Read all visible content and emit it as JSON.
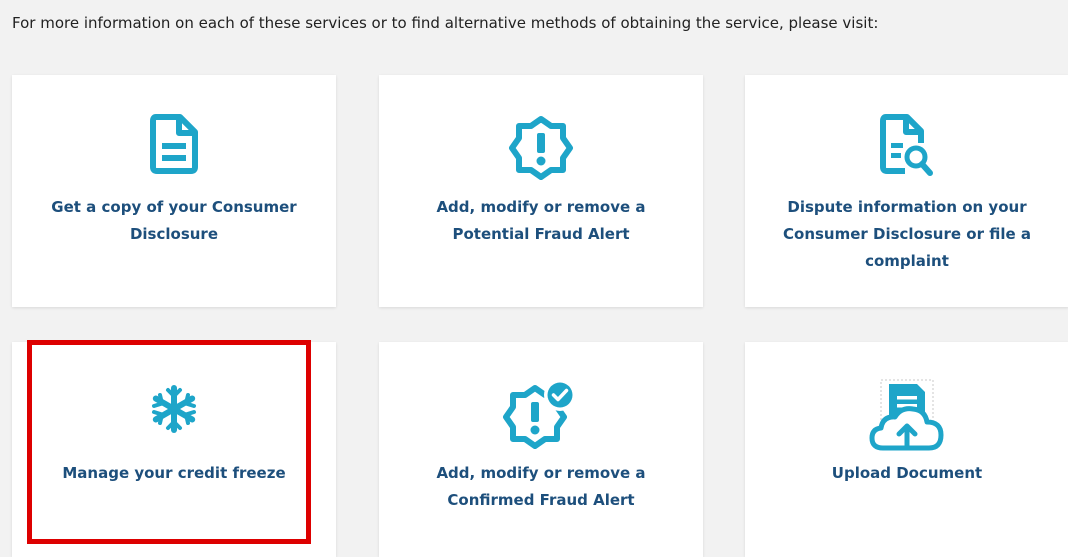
{
  "intro_text": "For more information on each of these services or to find alternative methods of obtaining the service, please visit:",
  "colors": {
    "icon": "#1ea5c9",
    "label": "#1d4f7c",
    "background": "#f2f2f2",
    "card": "#ffffff",
    "highlight": "#dd0000"
  },
  "services": [
    {
      "label": "Get a copy of your Consumer Disclosure",
      "icon": "document-icon"
    },
    {
      "label": "Add, modify or remove a Potential Fraud Alert",
      "icon": "alert-badge-icon"
    },
    {
      "label": "Dispute information on your Consumer Disclosure or file a complaint",
      "icon": "document-search-icon"
    },
    {
      "label": "Manage your credit freeze",
      "icon": "snowflake-icon",
      "highlighted": true
    },
    {
      "label": "Add, modify or remove a Confirmed Fraud Alert",
      "icon": "alert-badge-check-icon"
    },
    {
      "label": "Upload Document",
      "icon": "cloud-upload-icon"
    }
  ]
}
